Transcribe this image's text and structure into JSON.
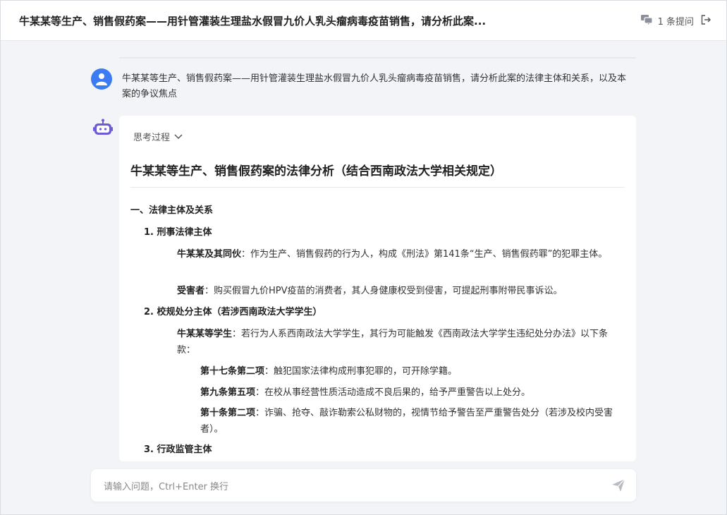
{
  "header": {
    "title": "牛某某等生产、销售假药案——用针管灌装生理盐水假冒九价人乳头瘤病毒疫苗销售，请分析此案...",
    "question_count": "1 条提问"
  },
  "user_message": {
    "text": "牛某某等生产、销售假药案——用针管灌装生理盐水假冒九价人乳头瘤病毒疫苗销售，请分析此案的法律主体和关系，以及本案的争议焦点"
  },
  "answer": {
    "thinking_label": "思考过程",
    "heading": "牛某某等生产、销售假药案的法律分析（结合西南政法大学相关规定）",
    "section1": "一、法律主体及关系",
    "item1": "1. 刑事法律主体",
    "item1_a_label": "牛某某及其同伙",
    "item1_a_text": "：作为生产、销售假药的行为人，构成《刑法》第141条“生产、销售假药罪”的犯罪主体。",
    "item1_b_label": "受害者",
    "item1_b_text": "：购买假冒九价HPV疫苗的消费者，其人身健康权受到侵害，可提起刑事附带民事诉讼。",
    "item2": "2. 校规处分主体（若涉西南政法大学学生）",
    "item2_a_label": "牛某某等学生",
    "item2_a_text": "：若行为人系西南政法大学学生，其行为可能触发《西南政法大学学生违纪处分办法》以下条款：",
    "clause1_label": "第十七条第二项",
    "clause1_text": "：触犯国家法律构成刑事犯罪的，可开除学籍。",
    "clause2_label": "第九条第五项",
    "clause2_text": "：在校从事经营性质活动造成不良后果的，给予严重警告以上处分。",
    "clause3_label": "第十条第二项",
    "clause3_text": "：诈骗、抢夺、敲诈勒索公私财物的，视情节给予警告至严重警告处分（若涉及校内受害者）。",
    "item3": "3. 行政监管主体"
  },
  "input": {
    "placeholder": "请输入问题，Ctrl+Enter 换行"
  },
  "colors": {
    "accent": "#3d7bf5",
    "bot_avatar": "#6b5bd6"
  }
}
